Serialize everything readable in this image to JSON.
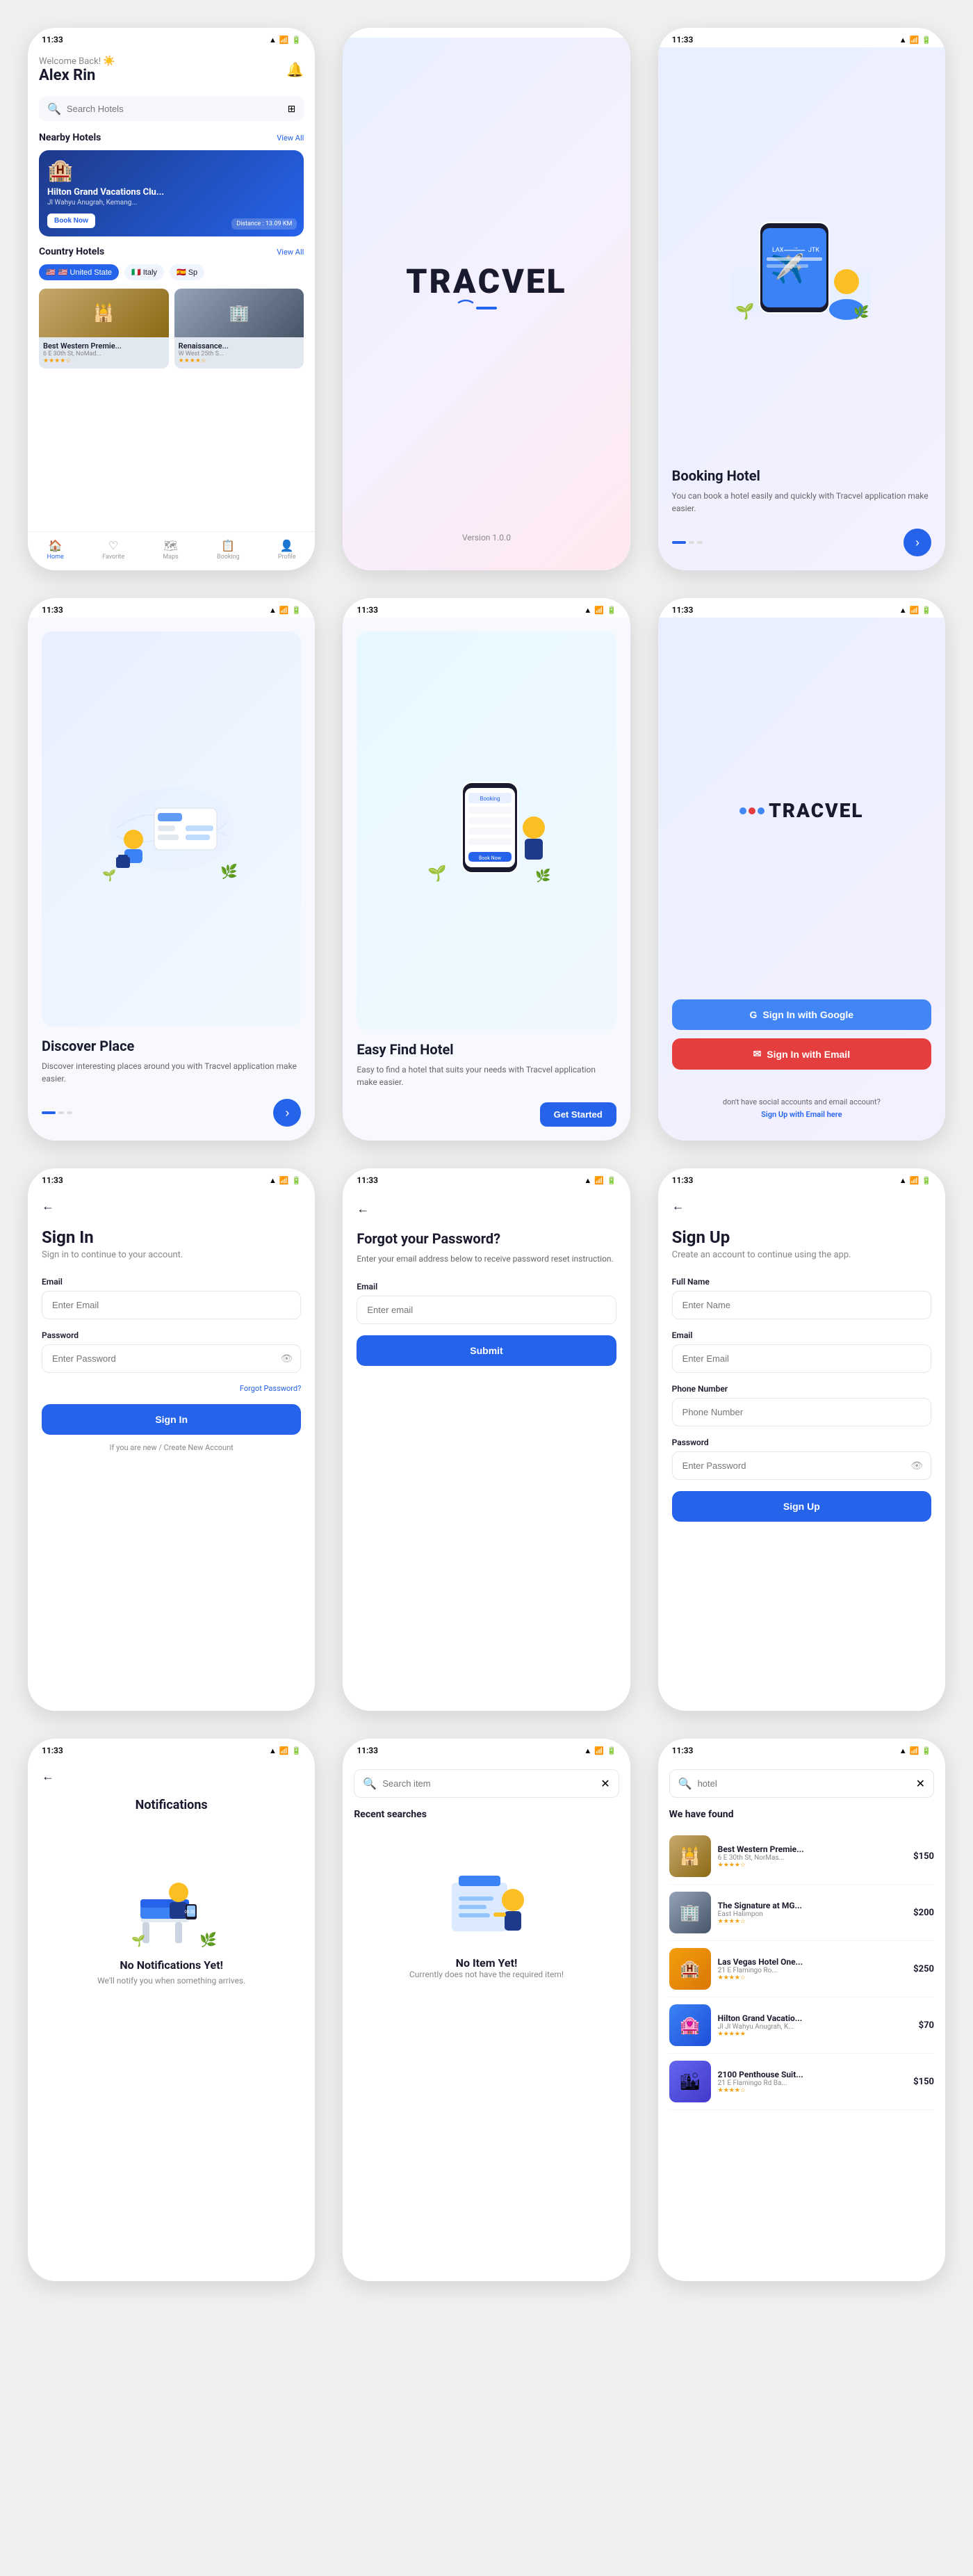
{
  "screens": {
    "home": {
      "statusTime": "11:33",
      "welcome": "Welcome Back!",
      "emoji": "☀️",
      "userName": "Alex Rin",
      "searchPlaceholder": "Search Hotels",
      "nearbyTitle": "Nearby Hotels",
      "viewAll1": "View All",
      "featuredHotel": {
        "name": "Hilton Grand Vacations Clu...",
        "location": "Jl Wahyu Anugrah, Kemang...",
        "bookBtn": "Book Now",
        "distance": "Distance : 13.09 KM"
      },
      "countryTitle": "Country Hotels",
      "viewAll2": "View All",
      "countries": [
        "🇺🇸 United State",
        "🇮🇹 Italy",
        "🇪🇸 Sp"
      ],
      "hotels": [
        {
          "name": "Best Western Premie...",
          "location": "6 E 30th St, NoMad...",
          "rating": "★★★★☆",
          "price": ""
        },
        {
          "name": "Renaissance...",
          "location": "W West 25th S...",
          "rating": "★★★★☆",
          "price": ""
        }
      ],
      "navItems": [
        "Home",
        "Favorite",
        "Maps",
        "Booking",
        "Profile"
      ]
    },
    "splash": {
      "statusTime": "",
      "logo": "TRACVEL",
      "version": "Version 1.0.0"
    },
    "booking": {
      "statusTime": "11:33",
      "title": "Booking Hotel",
      "desc": "You can book a hotel easily and quickly with Tracvel application make easier."
    },
    "discover": {
      "statusTime": "11:33",
      "title": "Discover Place",
      "desc": "Discover interesting places around you with Tracvel application make easier."
    },
    "easyFind": {
      "statusTime": "11:33",
      "title": "Easy Find Hotel",
      "desc": "Easy to find a hotel that suits your needs with Tracvel application make easier.",
      "getStarted": "Get Started"
    },
    "socialAuth": {
      "statusTime": "11:33",
      "logoText": "TRACVEL",
      "googleBtn": "Sign In with Google",
      "emailBtn": "Sign In with Email",
      "noAccount": "don't have social accounts and email account?",
      "signupLink": "Sign Up with Email here"
    },
    "signIn": {
      "statusTime": "11:33",
      "title": "Sign In",
      "subtitle": "Sign in to continue to your account.",
      "emailLabel": "Email",
      "emailPlaceholder": "Enter Email",
      "passwordLabel": "Password",
      "passwordPlaceholder": "Enter Password",
      "forgotLink": "Forgot Password?",
      "signInBtn": "Sign In",
      "newAccountText": "If you are new / Create New Account"
    },
    "forgotPassword": {
      "statusTime": "11:33",
      "title": "Forgot your Password?",
      "desc": "Enter your email address below to receive password reset instruction.",
      "emailLabel": "Email",
      "emailPlaceholder": "Enter email",
      "submitBtn": "Submit"
    },
    "signUp": {
      "statusTime": "11:33",
      "title": "Sign Up",
      "subtitle": "Create an account to continue using the app.",
      "fullNameLabel": "Full Name",
      "fullNamePlaceholder": "Enter Name",
      "emailLabel": "Email",
      "emailPlaceholder": "Enter Email",
      "phoneLabel": "Phone Number",
      "phonePlaceholder": "Phone Number",
      "passwordLabel": "Password",
      "passwordPlaceholder": "Enter Password",
      "signUpBtn": "Sign Up"
    },
    "notifications": {
      "statusTime": "11:33",
      "title": "Notifications",
      "emptyTitle": "No Notifications Yet!",
      "emptyDesc": "We'll notify you when something arrives."
    },
    "searchEmpty": {
      "statusTime": "11:33",
      "searchPlaceholder": "Search item",
      "searchValue": "11.33 Search item",
      "recentTitle": "Recent searches",
      "noItemTitle": "No Item Yet!",
      "noItemDesc": "Currently does not have the required item!"
    },
    "searchResults": {
      "statusTime": "11:33",
      "searchValue": "hotel",
      "foundTitle": "We have found",
      "hotels": [
        {
          "name": "Best Western Premie...",
          "location": "6 E 30th St, NorMas...",
          "price": "$150",
          "rating": "★★★★☆",
          "color": "img-mosque"
        },
        {
          "name": "The Signature at MG...",
          "location": "East Halimpon",
          "price": "$200",
          "rating": "★★★★☆",
          "color": "img-building"
        },
        {
          "name": "Las Vegas Hotel One...",
          "location": "21 E Flamingo Ro...",
          "price": "$250",
          "rating": "★★★★☆",
          "color": "img-vegas"
        },
        {
          "name": "Hilton Grand Vacatio...",
          "location": "Jl JI Wahyu Anugrah, K...",
          "price": "$70",
          "rating": "★★★★★",
          "color": "img-hilton"
        },
        {
          "name": "2100 Penthouse Suit...",
          "location": "21 E Flamingo Rd Ba...",
          "price": "$150",
          "rating": "★★★★☆",
          "color": "img-penthouse"
        }
      ]
    }
  }
}
